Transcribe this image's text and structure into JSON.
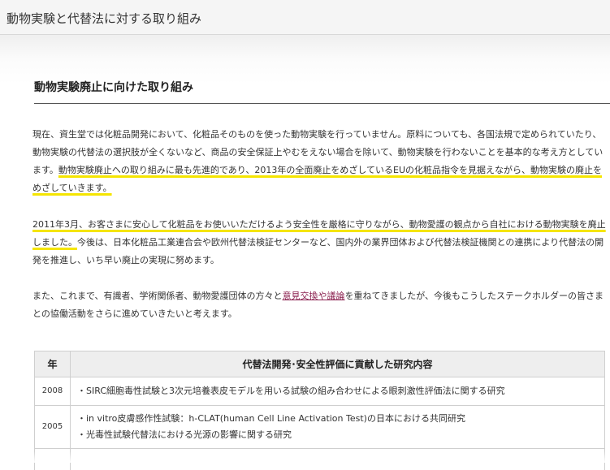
{
  "header": {
    "title": "動物実験と代替法に対する取り組み"
  },
  "section": {
    "title": "動物実験廃止に向けた取り組み"
  },
  "paragraphs": {
    "p1_text": "現在、資生堂では化粧品開発において、化粧品そのものを使った動物実験を行っていません。原料についても、各国法規で定められていたり、動物実験の代替法の選択肢が全くないなど、商品の安全保証上やむをえない場合を除いて、動物実験を行わないことを基本的な考え方としています。",
    "p1_highlight": "動物実験廃止への取り組みに最も先進的であり、2013年の全面廃止をめざしているEUの化粧品指令を見据えながら、動物実験の廃止をめざしていきます。",
    "p2_highlight": "2011年3月、お客さまに安心して化粧品をお使いいただけるよう安全性を厳格に守りながら、動物愛護の観点から自社における動物実験を廃止しました。",
    "p2_text": "今後は、日本化粧品工業連合会や欧州代替法検証センターなど、国内外の業界団体および代替法検証機関との連携により代替法の開発を推進し、いち早い廃止の実現に努めます。",
    "p3_before": "また、これまで、有識者、学術関係者、動物愛護団体の方々と",
    "p3_link": "意見交換や議論",
    "p3_after": "を重ねてきましたが、今後もこうしたステークホルダーの皆さまとの協働活動をさらに進めていきたいと考えます。"
  },
  "table": {
    "headers": {
      "year": "年",
      "content": "代替法開発･安全性評価に貢献した研究内容"
    },
    "rows": [
      {
        "year": "2008",
        "items": [
          "・SIRC細胞毒性試験と3次元培養表皮モデルを用いる試験の組み合わせによる眼刺激性評価法に関する研究"
        ]
      },
      {
        "year": "2005",
        "items": [
          "・in vitro皮膚感作性試験：h-CLAT(human Cell Line Activation Test)の日本における共同研究",
          "・光毒性試験代替法における光源の影響に関する研究"
        ]
      }
    ]
  },
  "colors": {
    "highlight_underline": "#f5e500",
    "link": "#8a1f4e",
    "table_header_bg": "#eeeeee"
  }
}
